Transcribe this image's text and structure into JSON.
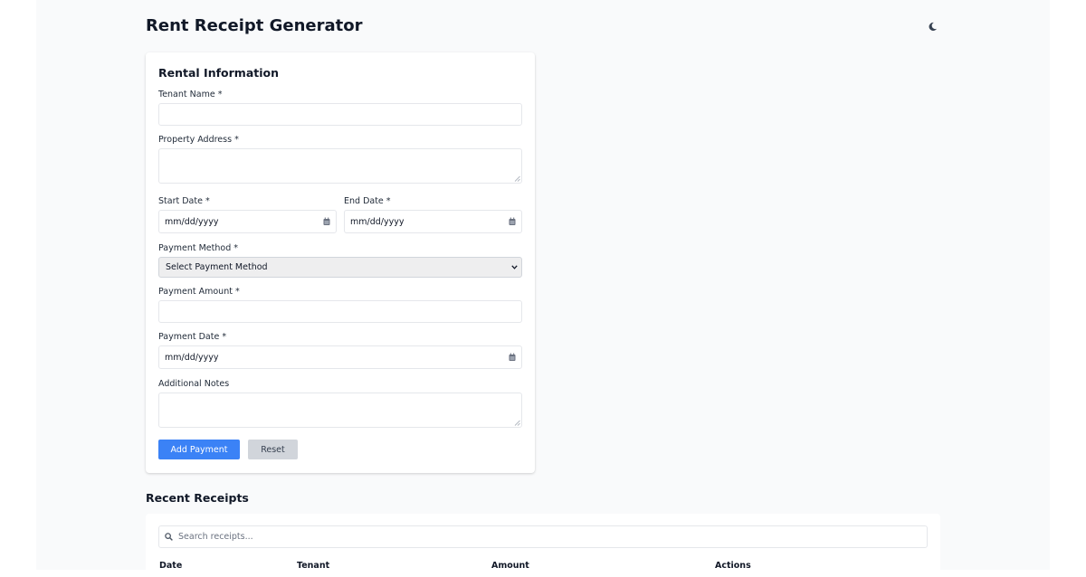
{
  "header": {
    "title": "Rent Receipt Generator",
    "theme_icon": "moon-icon"
  },
  "form": {
    "title": "Rental Information",
    "tenant_name": {
      "label": "Tenant Name *",
      "value": ""
    },
    "property_address": {
      "label": "Property Address *",
      "value": ""
    },
    "start_date": {
      "label": "Start Date *",
      "value": "mm/dd/yyyy"
    },
    "end_date": {
      "label": "End Date *",
      "value": "mm/dd/yyyy"
    },
    "payment_method": {
      "label": "Payment Method *",
      "selected": "Select Payment Method"
    },
    "payment_amount": {
      "label": "Payment Amount *",
      "value": ""
    },
    "payment_date": {
      "label": "Payment Date *",
      "value": "mm/dd/yyyy"
    },
    "notes": {
      "label": "Additional Notes",
      "value": ""
    },
    "add_button": "Add Payment",
    "reset_button": "Reset"
  },
  "receipts": {
    "title": "Recent Receipts",
    "search_placeholder": "Search receipts...",
    "columns": [
      "Date",
      "Tenant",
      "Amount",
      "Actions"
    ]
  },
  "colors": {
    "primary": "#3b82f6",
    "secondary": "#d1d5db",
    "background": "#f9fafb"
  }
}
